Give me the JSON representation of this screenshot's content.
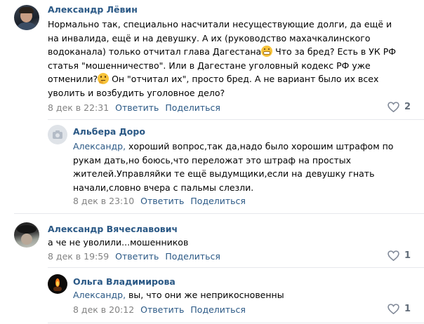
{
  "comments": [
    {
      "author": "Александр Лёвин",
      "lines": [
        "Нормально так, специально насчитали несуществующие долги, да ещё и",
        "на инвалида, ещё и на девушку. А их (руководство махачкалинского",
        "водоканала) только отчитал глава Дагестана",
        " Что за бред? Есть в УК РФ",
        "статья \"мошенничество\". Или в Дагестане уголовный кодекс РФ уже",
        "отменили?",
        " Он \"отчитал их\", просто бред. А не вариант было их всех",
        "уволить и возбудить уголовное дело?"
      ],
      "date": "8 дек в 22:31",
      "reply_label": "Ответить",
      "share_label": "Поделиться",
      "likes": "2",
      "emoji_1": "grimace-emoji",
      "emoji_2": "thinking-emoji"
    },
    {
      "author": "Альбера Доро",
      "reply_to": "Александр,",
      "lines": [
        " хороший вопрос,так да,надо было хорошим штрафом по",
        "рукам дать,но боюсь,что переложат это штраф на простых",
        "жителей.Управляйки те ещё выдумщики,если на девушку гнать",
        "начали,словно вчера с пальмы слезли."
      ],
      "date": "8 дек в 23:10",
      "reply_label": "Ответить",
      "share_label": "Поделиться",
      "avatar_icon": "camera-icon"
    },
    {
      "author": "Александр Вячеславович",
      "lines": [
        "а че не уволили...мошенников"
      ],
      "date": "8 дек в 19:59",
      "reply_label": "Ответить",
      "share_label": "Поделиться",
      "likes": "1"
    },
    {
      "author": "Ольга Владимирова",
      "reply_to": "Александр,",
      "lines": [
        " вы, что они же неприкосновенны"
      ],
      "date": "8 дек в 20:12",
      "reply_label": "Ответить",
      "share_label": "Поделиться",
      "likes": "1"
    }
  ],
  "colors": {
    "link": "#2a5885",
    "meta": "#828282",
    "divider": "#e7e8ec"
  }
}
